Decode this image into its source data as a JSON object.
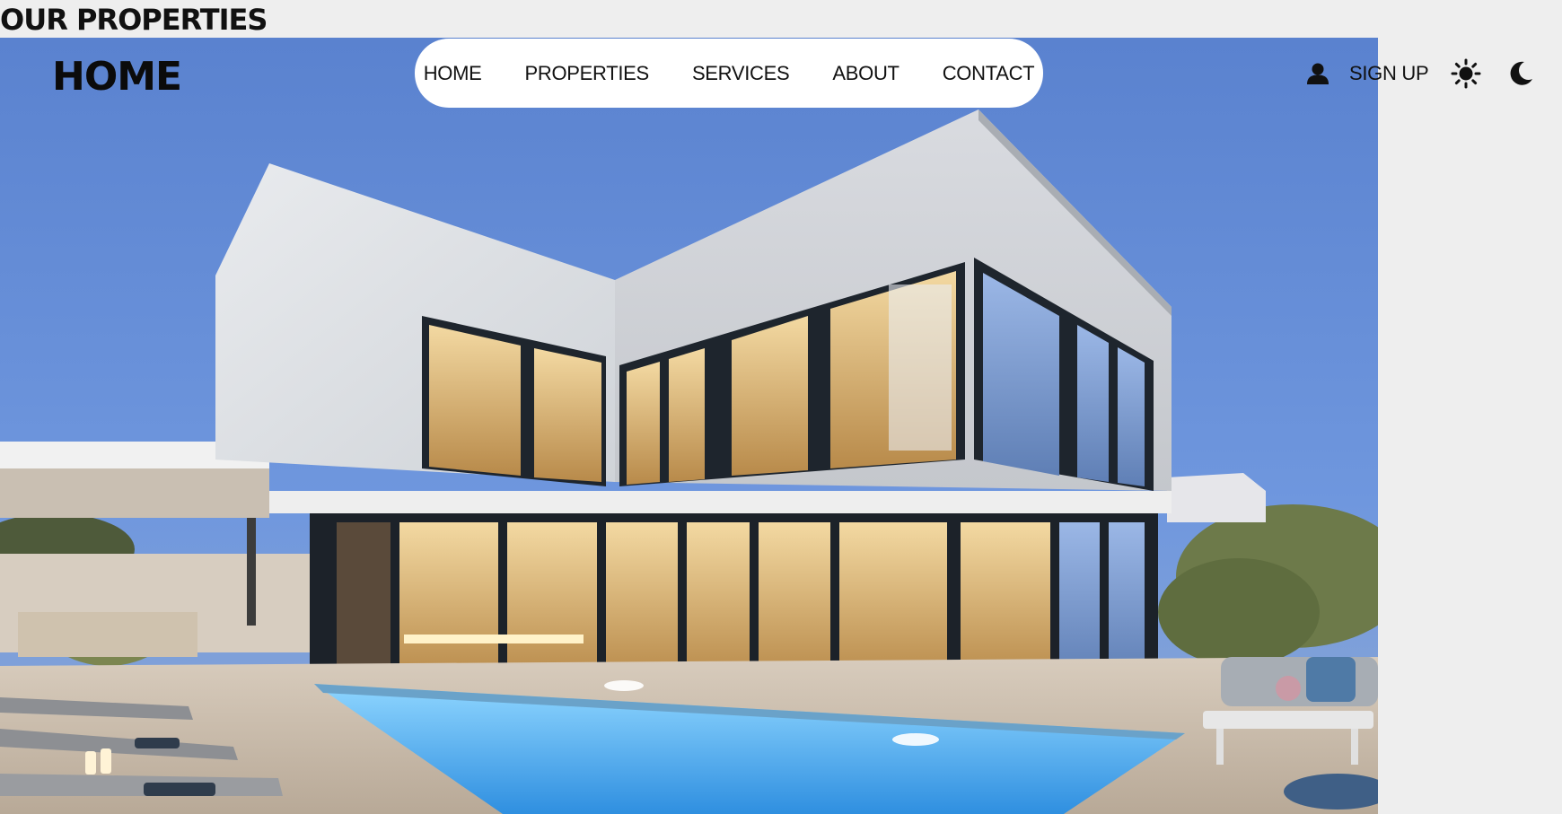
{
  "page": {
    "title": "OUR PROPERTIES"
  },
  "header": {
    "logo": "HOME"
  },
  "nav": {
    "items": [
      {
        "label": "HOME"
      },
      {
        "label": "PROPERTIES"
      },
      {
        "label": "SERVICES"
      },
      {
        "label": "ABOUT"
      },
      {
        "label": "CONTACT"
      }
    ]
  },
  "account": {
    "user_icon": "user-icon",
    "signup_label": "SIGN UP"
  },
  "theme": {
    "light_icon": "sun-icon",
    "dark_icon": "moon-icon"
  },
  "colors": {
    "page_bg": "#eeeeee",
    "nav_bg": "#ffffff",
    "sky": "#6a93dc",
    "pool": "#5fb6f0"
  }
}
